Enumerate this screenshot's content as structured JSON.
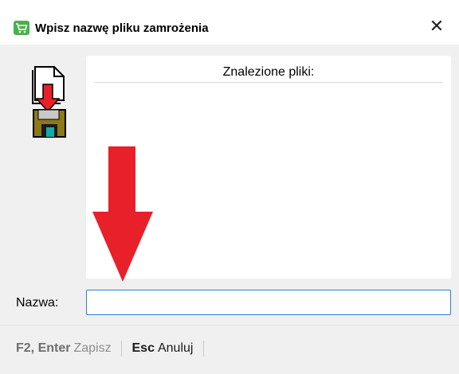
{
  "window": {
    "title": "Wpisz nazwę pliku zamrożenia",
    "close_label": "✕",
    "accent": "#4caf50"
  },
  "list": {
    "header": "Znalezione pliki:",
    "items": []
  },
  "form": {
    "name_label": "Nazwa:",
    "name_value": "",
    "input_border": "#2c7fd4"
  },
  "annotation": {
    "arrow_color": "#e8202a"
  },
  "footer": {
    "save_key": "F2, Enter",
    "save_label": "Zapisz",
    "cancel_key": "Esc",
    "cancel_label": "Anuluj"
  },
  "icons": [
    "cart-icon",
    "close-icon",
    "save-file-icon",
    "red-arrow-down-icon"
  ]
}
